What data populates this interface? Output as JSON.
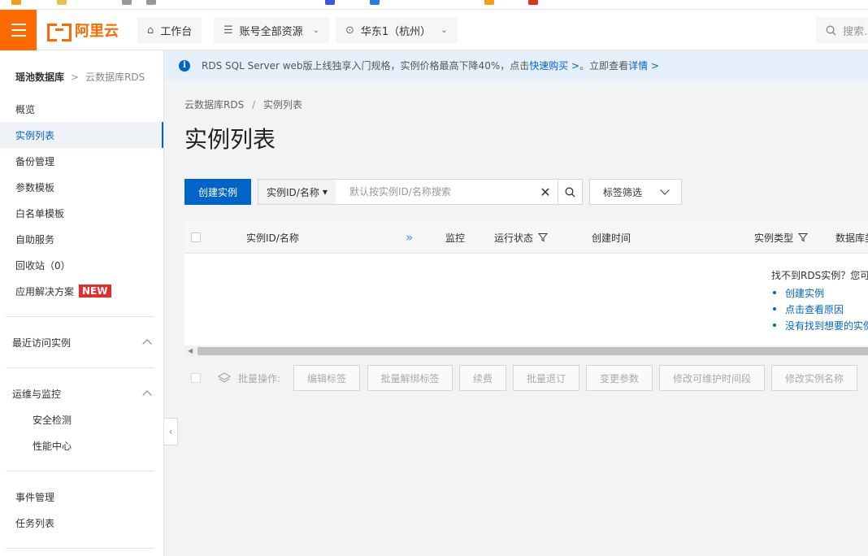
{
  "header": {
    "logo_text": "阿里云",
    "workbench_label": "工作台",
    "resources_label": "账号全部资源",
    "region_label": "华东1（杭州）",
    "search_placeholder": "搜索..."
  },
  "sidebar": {
    "breadcrumb_parent": "瑶池数据库",
    "breadcrumb_sep": ">",
    "breadcrumb_current": "云数据库RDS",
    "items": [
      {
        "label": "概览"
      },
      {
        "label": "实例列表"
      },
      {
        "label": "备份管理"
      },
      {
        "label": "参数模板"
      },
      {
        "label": "白名单模板"
      },
      {
        "label": "自助服务"
      },
      {
        "label": "回收站（0）"
      },
      {
        "label": "应用解决方案",
        "badge": "NEW"
      }
    ],
    "groups": [
      {
        "label": "最近访问实例"
      },
      {
        "label": "运维与监控",
        "children": [
          {
            "label": "安全检测"
          },
          {
            "label": "性能中心"
          }
        ]
      }
    ],
    "bottom_items": [
      {
        "label": "事件管理"
      },
      {
        "label": "任务列表"
      }
    ]
  },
  "notice": {
    "text": "RDS SQL Server web版上线独享入门规格，实例价格最高下降40%，点击",
    "link1": "快速购买 >",
    "mid": "。立即查看",
    "link2": "详情 >"
  },
  "main": {
    "breadcrumb": [
      "云数据库RDS",
      "/",
      "实例列表"
    ],
    "title": "实例列表",
    "create_button": "创建实例",
    "search_field_select": "实例ID/名称",
    "search_placeholder": "默认按实例ID/名称搜索",
    "tag_filter_label": "标签筛选",
    "table_headers": {
      "id_name": "实例ID/名称",
      "monitor": "监控",
      "status": "运行状态",
      "created": "创建时间",
      "type": "实例类型",
      "db": "数据库类型"
    },
    "empty": {
      "tip": "找不到RDS实例？您可",
      "links": [
        "创建实例",
        "点击查看原因",
        "没有找到想要的实例？"
      ]
    },
    "batch": {
      "label": "批量操作:",
      "buttons": [
        "编辑标签",
        "批量解绑标签",
        "续费",
        "批量退订",
        "变更参数",
        "修改可维护时间段",
        "修改实例名称"
      ]
    }
  }
}
